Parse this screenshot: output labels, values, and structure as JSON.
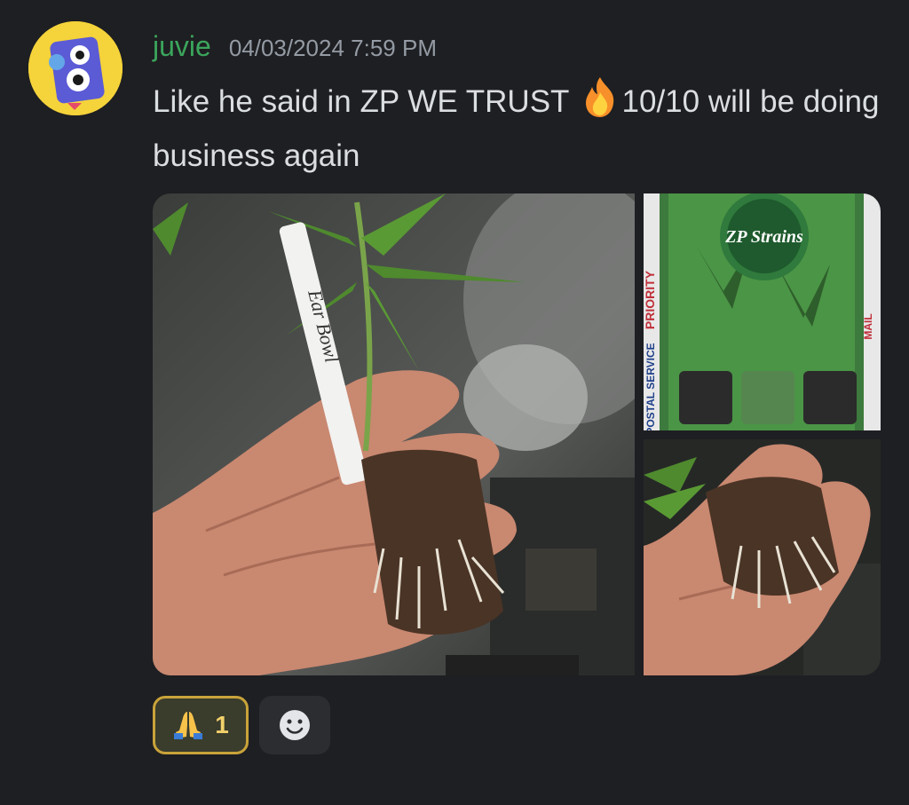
{
  "message": {
    "author": "juvie",
    "timestamp": "04/03/2024 7:59 PM",
    "text_before_emoji": "Like he said in ZP WE TRUST ",
    "text_after_emoji": "10/10 will be doing business again",
    "emoji": "fire-emoji"
  },
  "attachments": {
    "main": {
      "plant_label_text": "Ear Bowl"
    },
    "top_right": {
      "brand_text": "ZP Strains",
      "box_text": "PRIORITY",
      "service_text": "POSTAL SERVICE",
      "mail_text": "MAIL"
    }
  },
  "reactions": [
    {
      "emoji": "folded-hands-emoji",
      "count": "1"
    }
  ],
  "colors": {
    "background": "#1e1f22",
    "username": "#3ba55c",
    "timestamp": "#949ba4",
    "text": "#dbdee1",
    "reaction_border": "#c9a33a"
  }
}
